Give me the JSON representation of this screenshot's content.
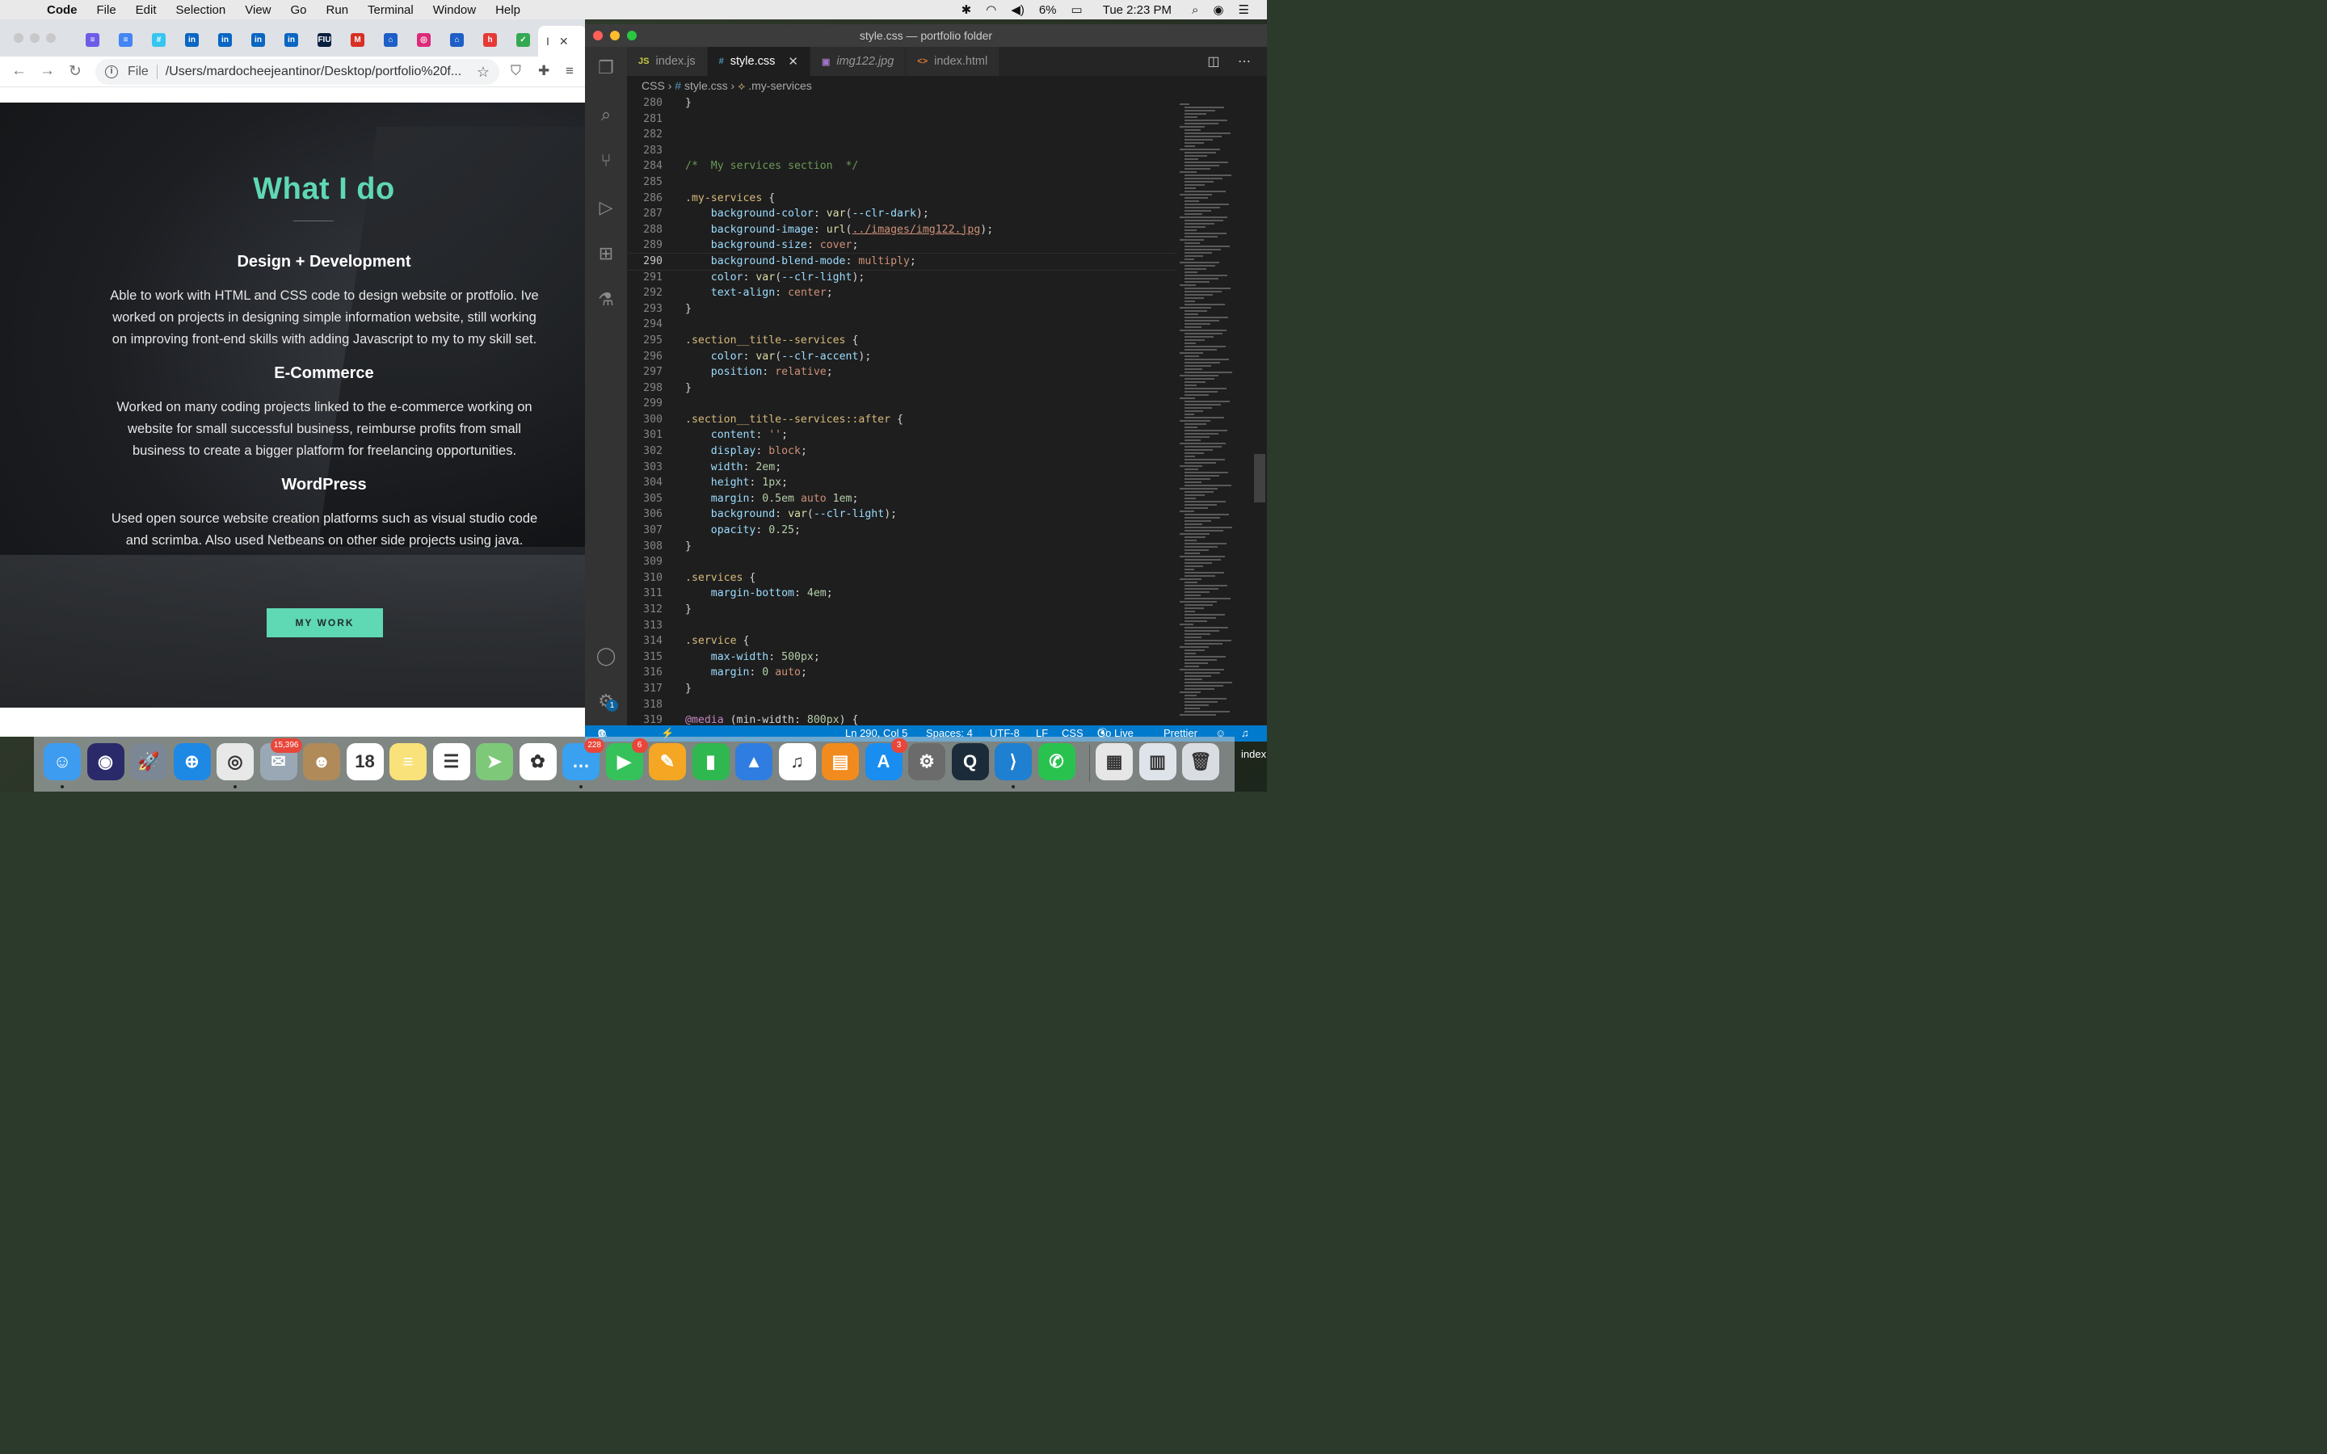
{
  "menubar": {
    "apple": "",
    "items": [
      "Code",
      "File",
      "Edit",
      "Selection",
      "View",
      "Go",
      "Run",
      "Terminal",
      "Window",
      "Help"
    ],
    "battery": "6%",
    "clock": "Tue 2:23 PM"
  },
  "browser": {
    "favicons": [
      {
        "name": "rainbow",
        "label": "≡",
        "color": "#6c5ce7"
      },
      {
        "name": "docs",
        "label": "≡",
        "color": "#4285f4"
      },
      {
        "name": "slack",
        "label": "#",
        "color": "#36c5f0"
      },
      {
        "name": "linkedin",
        "label": "in",
        "color": "#0a66c2"
      },
      {
        "name": "linkedin",
        "label": "in",
        "color": "#0a66c2"
      },
      {
        "name": "linkedin",
        "label": "in",
        "color": "#0a66c2"
      },
      {
        "name": "linkedin",
        "label": "in",
        "color": "#0a66c2"
      },
      {
        "name": "fiu",
        "label": "FIU",
        "color": "#081e3f"
      },
      {
        "name": "gmail",
        "label": "M",
        "color": "#d93025"
      },
      {
        "name": "handshake",
        "label": "⌂",
        "color": "#1d5ec7"
      },
      {
        "name": "instagram",
        "label": "◎",
        "color": "#dd2a7b"
      },
      {
        "name": "handshake",
        "label": "⌂",
        "color": "#1d5ec7"
      },
      {
        "name": "handshake",
        "label": "h",
        "color": "#e53935"
      },
      {
        "name": "check",
        "label": "✓",
        "color": "#34a853"
      }
    ],
    "active_tab_label": "I",
    "omnibox": {
      "scheme": "File",
      "url": "/Users/mardocheejeantinor/Desktop/portfolio%20f..."
    }
  },
  "page": {
    "heading": "What I do",
    "services": [
      {
        "title": "Design + Development",
        "text": "Able to work with HTML and CSS code to design website or protfolio. Ive worked on projects in designing simple information website, still working on improving front-end skills with adding Javascript to my to my skill set."
      },
      {
        "title": "E-Commerce",
        "text": "Worked on many coding projects linked to the e-commerce working on website for small successful business, reimburse profits from small business to create a bigger platform for freelancing opportunities."
      },
      {
        "title": "WordPress",
        "text": "Used open source website creation platforms such as visual studio code and scrimba. Also used Netbeans on other side projects using java."
      }
    ],
    "cta": "MY WORK"
  },
  "vscode": {
    "window_title": "style.css — portfolio folder",
    "tabs": [
      {
        "icon": "JS",
        "label": "index.js",
        "active": false,
        "italic": false
      },
      {
        "icon": "#",
        "label": "style.css",
        "active": true,
        "italic": false
      },
      {
        "icon": "▣",
        "label": "img122.jpg",
        "active": false,
        "italic": true
      },
      {
        "icon": "<>",
        "label": "index.html",
        "active": false,
        "italic": false
      }
    ],
    "breadcrumb": {
      "part1": "CSS",
      "part2": "style.css",
      "part3": ".my-services"
    },
    "code_lines": [
      {
        "n": "280",
        "html": "<span class='t-p'>}</span>"
      },
      {
        "n": "281",
        "html": ""
      },
      {
        "n": "282",
        "html": ""
      },
      {
        "n": "283",
        "html": ""
      },
      {
        "n": "284",
        "html": "<span class='t-com'>/*  My services section  */</span>"
      },
      {
        "n": "285",
        "html": ""
      },
      {
        "n": "286",
        "html": "<span class='t-sel'>.my-services</span> <span class='t-p'>{</span>"
      },
      {
        "n": "287",
        "html": "    <span class='t-prop'>background-color</span><span class='t-p'>: </span><span class='t-fn'>var</span><span class='t-p'>(</span><span class='t-var'>--clr-dark</span><span class='t-p'>);</span>"
      },
      {
        "n": "288",
        "html": "    <span class='t-prop'>background-image</span><span class='t-p'>: </span><span class='t-fn'>url</span><span class='t-p'>(</span><span class='t-url'>../images/img122.jpg</span><span class='t-p'>);</span>"
      },
      {
        "n": "289",
        "html": "    <span class='t-prop'>background-size</span><span class='t-p'>: </span><span class='t-val'>cover</span><span class='t-p'>;</span>"
      },
      {
        "n": "290",
        "html": "    <span class='t-prop'>background-blend-mode</span><span class='t-p'>: </span><span class='t-val'>multiply</span><span class='t-p'>;</span>"
      },
      {
        "n": "291",
        "html": "    <span class='t-prop'>color</span><span class='t-p'>: </span><span class='t-fn'>var</span><span class='t-p'>(</span><span class='t-var'>--clr-light</span><span class='t-p'>);</span>"
      },
      {
        "n": "292",
        "html": "    <span class='t-prop'>text-align</span><span class='t-p'>: </span><span class='t-val'>center</span><span class='t-p'>;</span>"
      },
      {
        "n": "293",
        "html": "<span class='t-p'>}</span>"
      },
      {
        "n": "294",
        "html": ""
      },
      {
        "n": "295",
        "html": "<span class='t-sel'>.section__title--services</span> <span class='t-p'>{</span>"
      },
      {
        "n": "296",
        "html": "    <span class='t-prop'>color</span><span class='t-p'>: </span><span class='t-fn'>var</span><span class='t-p'>(</span><span class='t-var'>--clr-accent</span><span class='t-p'>);</span>"
      },
      {
        "n": "297",
        "html": "    <span class='t-prop'>position</span><span class='t-p'>: </span><span class='t-val'>relative</span><span class='t-p'>;</span>"
      },
      {
        "n": "298",
        "html": "<span class='t-p'>}</span>"
      },
      {
        "n": "299",
        "html": ""
      },
      {
        "n": "300",
        "html": "<span class='t-sel'>.section__title--services::after</span> <span class='t-p'>{</span>"
      },
      {
        "n": "301",
        "html": "    <span class='t-prop'>content</span><span class='t-p'>: </span><span class='t-val'>''</span><span class='t-p'>;</span>"
      },
      {
        "n": "302",
        "html": "    <span class='t-prop'>display</span><span class='t-p'>: </span><span class='t-val'>block</span><span class='t-p'>;</span>"
      },
      {
        "n": "303",
        "html": "    <span class='t-prop'>width</span><span class='t-p'>: </span><span class='t-num'>2em</span><span class='t-p'>;</span>"
      },
      {
        "n": "304",
        "html": "    <span class='t-prop'>height</span><span class='t-p'>: </span><span class='t-num'>1px</span><span class='t-p'>;</span>"
      },
      {
        "n": "305",
        "html": "    <span class='t-prop'>margin</span><span class='t-p'>: </span><span class='t-num'>0.5em</span> <span class='t-val'>auto</span> <span class='t-num'>1em</span><span class='t-p'>;</span>"
      },
      {
        "n": "306",
        "html": "    <span class='t-prop'>background</span><span class='t-p'>: </span><span class='t-fn'>var</span><span class='t-p'>(</span><span class='t-var'>--clr-light</span><span class='t-p'>);</span>"
      },
      {
        "n": "307",
        "html": "    <span class='t-prop'>opacity</span><span class='t-p'>: </span><span class='t-num'>0.25</span><span class='t-p'>;</span>"
      },
      {
        "n": "308",
        "html": "<span class='t-p'>}</span>"
      },
      {
        "n": "309",
        "html": ""
      },
      {
        "n": "310",
        "html": "<span class='t-sel'>.services</span> <span class='t-p'>{</span>"
      },
      {
        "n": "311",
        "html": "    <span class='t-prop'>margin-bottom</span><span class='t-p'>: </span><span class='t-num'>4em</span><span class='t-p'>;</span>"
      },
      {
        "n": "312",
        "html": "<span class='t-p'>}</span>"
      },
      {
        "n": "313",
        "html": ""
      },
      {
        "n": "314",
        "html": "<span class='t-sel'>.service</span> <span class='t-p'>{</span>"
      },
      {
        "n": "315",
        "html": "    <span class='t-prop'>max-width</span><span class='t-p'>: </span><span class='t-num'>500px</span><span class='t-p'>;</span>"
      },
      {
        "n": "316",
        "html": "    <span class='t-prop'>margin</span><span class='t-p'>: </span><span class='t-num'>0</span> <span class='t-val'>auto</span><span class='t-p'>;</span>"
      },
      {
        "n": "317",
        "html": "<span class='t-p'>}</span>"
      },
      {
        "n": "318",
        "html": ""
      },
      {
        "n": "319",
        "html": "<span class='t-at'>@media</span> <span class='t-p'>(min-width: </span><span class='t-num'>800px</span><span class='t-p'>) {</span>"
      }
    ],
    "status": {
      "errors": "0",
      "warnings": "0",
      "position": "Ln 290, Col 5",
      "spaces": "Spaces: 4",
      "encoding": "UTF-8",
      "eol": "LF",
      "language": "CSS",
      "golive": "Go Live",
      "formatter": "Prettier"
    },
    "settings_badge": "1"
  },
  "dock": {
    "apps": [
      {
        "name": "finder",
        "color": "#3d9cf0",
        "glyph": "☺",
        "running": true
      },
      {
        "name": "siri",
        "color": "#2a2a6a",
        "glyph": "◉",
        "running": false
      },
      {
        "name": "launchpad",
        "color": "#7b8794",
        "glyph": "🚀",
        "running": false
      },
      {
        "name": "safari",
        "color": "#1e88e5",
        "glyph": "⊕",
        "running": false
      },
      {
        "name": "chrome",
        "color": "#e8e8e8",
        "glyph": "◎",
        "running": true
      },
      {
        "name": "mail",
        "color": "#9aa8b6",
        "glyph": "✉",
        "badge": "15,396",
        "running": false
      },
      {
        "name": "contacts",
        "color": "#b08a58",
        "glyph": "☻",
        "running": false
      },
      {
        "name": "calendar",
        "color": "#ffffff",
        "glyph": "18",
        "running": false
      },
      {
        "name": "notes",
        "color": "#f9e27a",
        "glyph": "≡",
        "running": false
      },
      {
        "name": "reminders",
        "color": "#ffffff",
        "glyph": "☰",
        "running": false
      },
      {
        "name": "maps",
        "color": "#7ec87a",
        "glyph": "➤",
        "running": false
      },
      {
        "name": "photos",
        "color": "#ffffff",
        "glyph": "✿",
        "running": false
      },
      {
        "name": "messages",
        "color": "#3aa0f0",
        "glyph": "…",
        "badge": "228",
        "running": true
      },
      {
        "name": "facetime",
        "color": "#36c25a",
        "glyph": "▶",
        "badge": "6",
        "running": false
      },
      {
        "name": "pages",
        "color": "#f5a623",
        "glyph": "✎",
        "running": false
      },
      {
        "name": "numbers",
        "color": "#2fb84f",
        "glyph": "▮",
        "running": false
      },
      {
        "name": "keynote",
        "color": "#2f7de1",
        "glyph": "▲",
        "running": false
      },
      {
        "name": "music",
        "color": "#ffffff",
        "glyph": "♫",
        "running": false
      },
      {
        "name": "books",
        "color": "#f28b1d",
        "glyph": "▤",
        "running": false
      },
      {
        "name": "appstore",
        "color": "#1a8df0",
        "glyph": "A",
        "badge": "3",
        "running": false
      },
      {
        "name": "system-preferences",
        "color": "#6b6b6b",
        "glyph": "⚙",
        "running": false
      },
      {
        "name": "quicktime",
        "color": "#1c2b3a",
        "glyph": "Q",
        "running": false
      },
      {
        "name": "vscode",
        "color": "#1f7fd0",
        "glyph": "⟩",
        "running": true
      },
      {
        "name": "whatsapp",
        "color": "#2ac24f",
        "glyph": "✆",
        "running": false
      },
      {
        "name": "documents",
        "color": "#e6e6e6",
        "glyph": "▦",
        "running": false
      },
      {
        "name": "downloads",
        "color": "#dfe4ea",
        "glyph": "▥",
        "running": false
      },
      {
        "name": "trash",
        "color": "#d9dde2",
        "glyph": "🗑",
        "running": false
      }
    ],
    "desktop_label": "index"
  }
}
